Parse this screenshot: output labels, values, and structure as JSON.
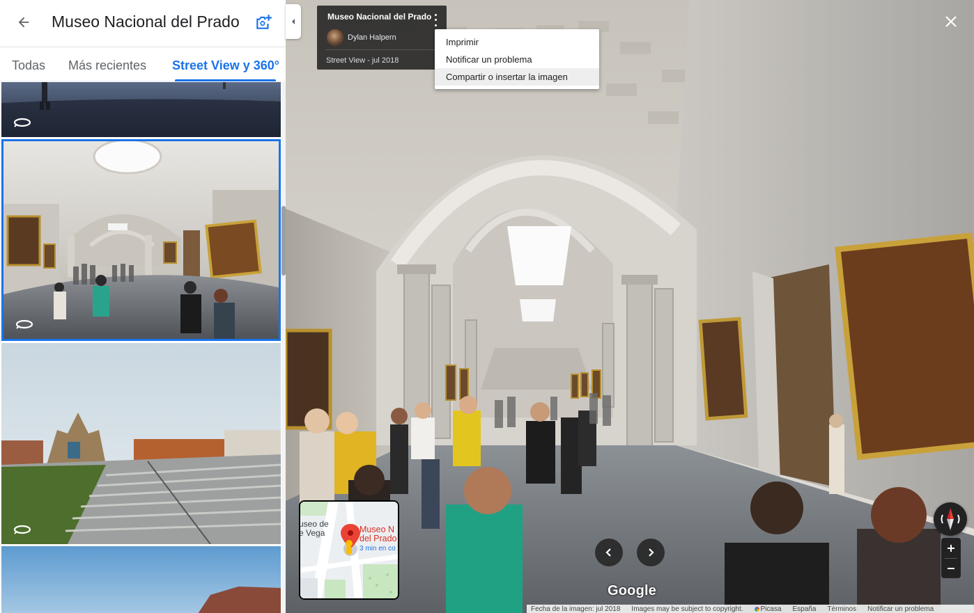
{
  "left_panel": {
    "title": "Museo Nacional del Prado",
    "tabs": [
      {
        "label": "Todas",
        "selected": false
      },
      {
        "label": "Más recientes",
        "selected": false
      },
      {
        "label": "Street View y 360°",
        "selected": true
      }
    ],
    "accent_color": "#1a73e8"
  },
  "viewer": {
    "info_card": {
      "title": "Museo Nacional del Prado",
      "author": "Dylan Halpern",
      "date": "Street View - jul 2018"
    },
    "menu": {
      "items": [
        {
          "label": "Imprimir"
        },
        {
          "label": "Notificar un problema"
        },
        {
          "label": "Compartir o insertar la imagen"
        }
      ]
    },
    "minimap": {
      "labels": [
        "useo de",
        "e Vega",
        "Museo N",
        "del Prado",
        "3 min en co"
      ]
    },
    "google_logo": "Google",
    "footer": {
      "image_date": "Fecha de la imagen: jul 2018",
      "copyright": "Images may be subject to copyright.",
      "picasa": "Picasa",
      "country": "España",
      "terms": "Términos",
      "report": "Notificar un problema"
    }
  }
}
